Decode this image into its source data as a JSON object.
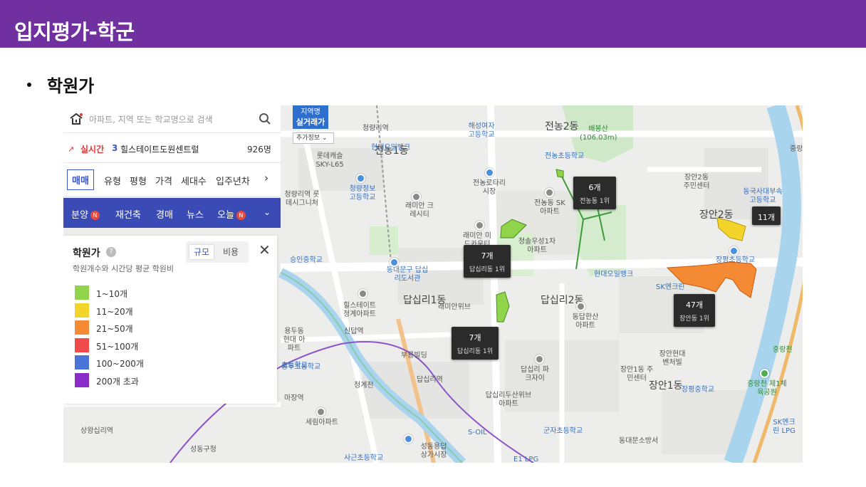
{
  "slide": {
    "title": "입지평가-학군",
    "bullet": "학원가"
  },
  "search": {
    "placeholder": "아파트, 지역 또는 학교명으로 검색"
  },
  "realtime": {
    "label": "실시간",
    "rank": "3",
    "name": "힐스테이트도원센트럴",
    "count": "926명"
  },
  "filters": [
    "매매",
    "유형",
    "평형",
    "가격",
    "세대수",
    "입주년차"
  ],
  "nav": {
    "items": [
      "분양",
      "재건축",
      "경매",
      "뉴스",
      "오늘"
    ],
    "new_badge": "N"
  },
  "map_buttons": {
    "region_line1": "지역명",
    "region_line2": "실거래가",
    "extra_info": "추가정보"
  },
  "legend": {
    "title": "학원가",
    "help": "?",
    "tab_scale": "규모",
    "tab_cost": "비용",
    "close": "✕",
    "description": "학원개수와 시간당 평균 학원비",
    "items": [
      {
        "label": "1~10개",
        "color": "#8fd44a"
      },
      {
        "label": "11~20개",
        "color": "#f2d42a"
      },
      {
        "label": "21~50개",
        "color": "#f48a33"
      },
      {
        "label": "51~100개",
        "color": "#f04a4a"
      },
      {
        "label": "100~200개",
        "color": "#4a74d8"
      },
      {
        "label": "200개 초과",
        "color": "#8a2cc8"
      }
    ]
  },
  "badges": [
    {
      "count": "6개",
      "sub": "전농동 1위"
    },
    {
      "count": "11개",
      "sub": ""
    },
    {
      "count": "7개",
      "sub": "답십리동 1위"
    },
    {
      "count": "47개",
      "sub": "장안동 1위"
    },
    {
      "count": "7개",
      "sub": "답십리동 1위"
    }
  ],
  "map_labels": {
    "dong": [
      "전농2동",
      "전농1동",
      "답십리1동",
      "답십리2동",
      "장안1동",
      "장안2동"
    ],
    "places": [
      "청량리역",
      "롯데캐슬 SKY-L65",
      "현대오일뱅크",
      "해성여자 고등학교",
      "배봉산 (106.03m)",
      "전농초등학교",
      "장안2동 주민센터",
      "동국사대부속 고등학교",
      "중랑",
      "청량리역 롯데시그니처",
      "청량정보 고등학교",
      "래미안 크레시티",
      "전농로타리 시장",
      "래미안 미드카운티",
      "전농동 SK아파트",
      "청솔우성1차 아파트",
      "장평초등학교",
      "승인중학교",
      "동대문구 답십리도서관",
      "현대오일뱅크",
      "SK엔크린",
      "힐스테이트 청계아파트",
      "래미안위브",
      "동답한산 아파트",
      "신답역",
      "용두동현대 아파트",
      "부룡빌딩",
      "장안현대 벤처빌",
      "장안1동 주민센터",
      "장평중학교",
      "중랑천",
      "중랑천 제1체육공원",
      "용두초등학교",
      "답십리역",
      "답십리 파크자이",
      "청계천",
      "마장역",
      "답십리두산위브 아파트",
      "세림아파트",
      "S-OIL",
      "군자초등학교",
      "SK엔크린 LPG",
      "상왕십리역",
      "성동구청",
      "사근초등학교",
      "성동용답 상가시장",
      "E1 LPG",
      "동대문소방서",
      "초등학교"
    ]
  }
}
